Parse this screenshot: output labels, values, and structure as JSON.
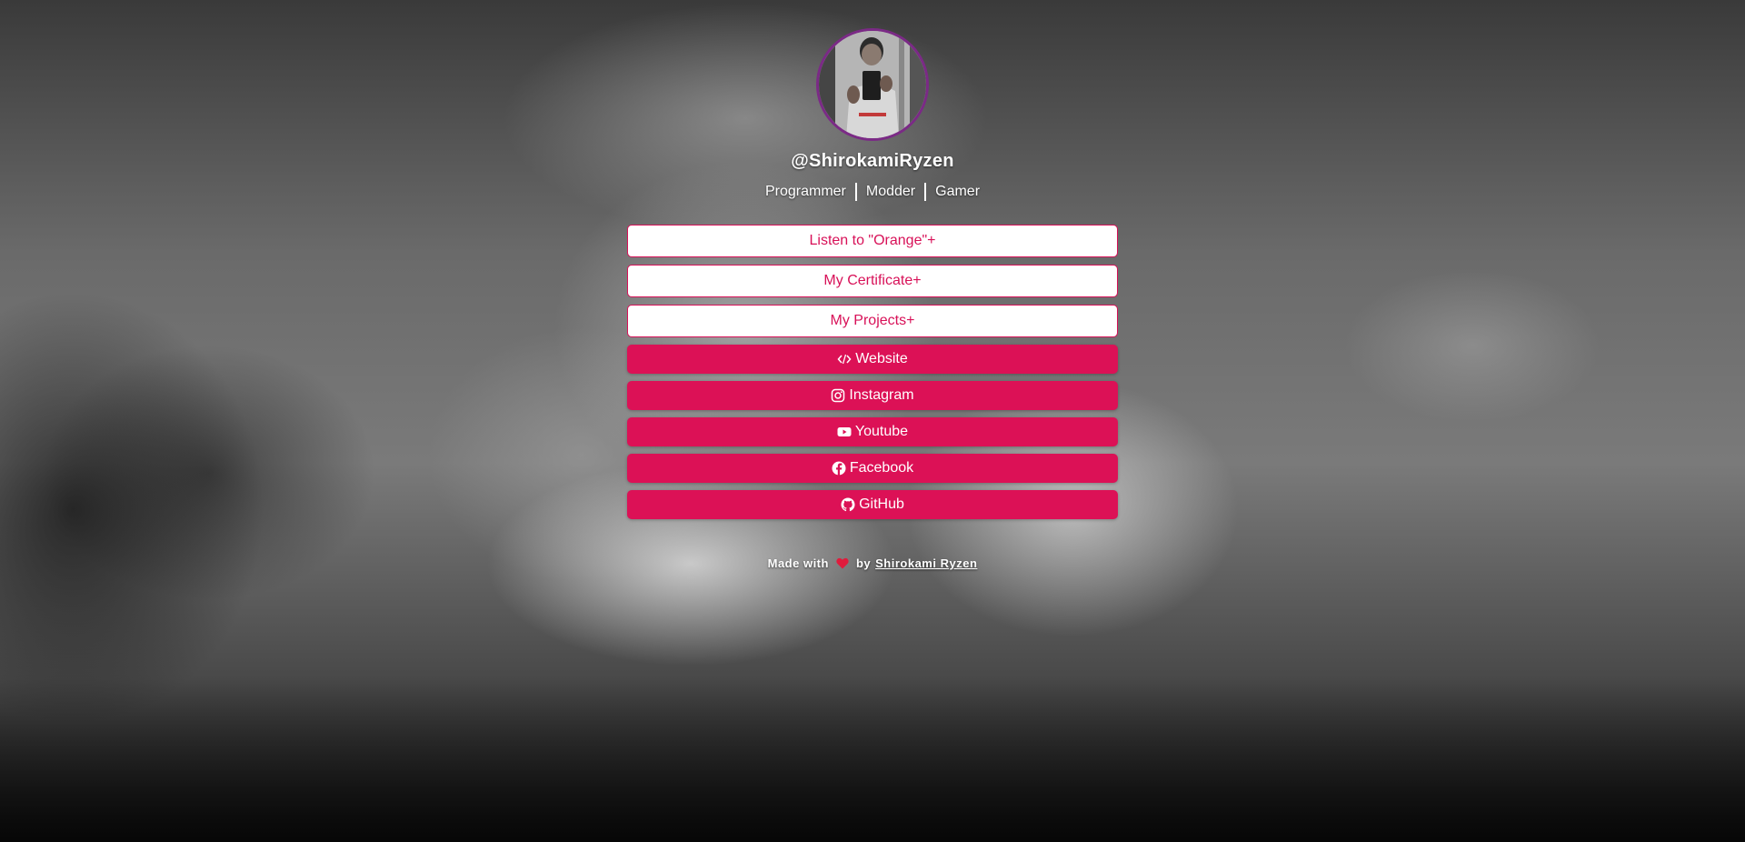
{
  "profile": {
    "username": "@ShirokamiRyzen",
    "tags": [
      "Programmer",
      "Modder",
      "Gamer"
    ]
  },
  "links": {
    "outline": [
      {
        "label": "Listen to \"Orange\"+"
      },
      {
        "label": "My Certificate+"
      },
      {
        "label": "My Projects+"
      }
    ],
    "social": [
      {
        "label": "Website",
        "icon": "code-icon"
      },
      {
        "label": "Instagram",
        "icon": "instagram-icon"
      },
      {
        "label": "Youtube",
        "icon": "youtube-icon"
      },
      {
        "label": "Facebook",
        "icon": "facebook-icon"
      },
      {
        "label": "GitHub",
        "icon": "github-icon"
      }
    ]
  },
  "footer": {
    "made_with": "Made with",
    "by": "by",
    "author": "Shirokami Ryzen"
  },
  "colors": {
    "accent": "#dc1156",
    "avatar_border": "#7b2a86"
  }
}
